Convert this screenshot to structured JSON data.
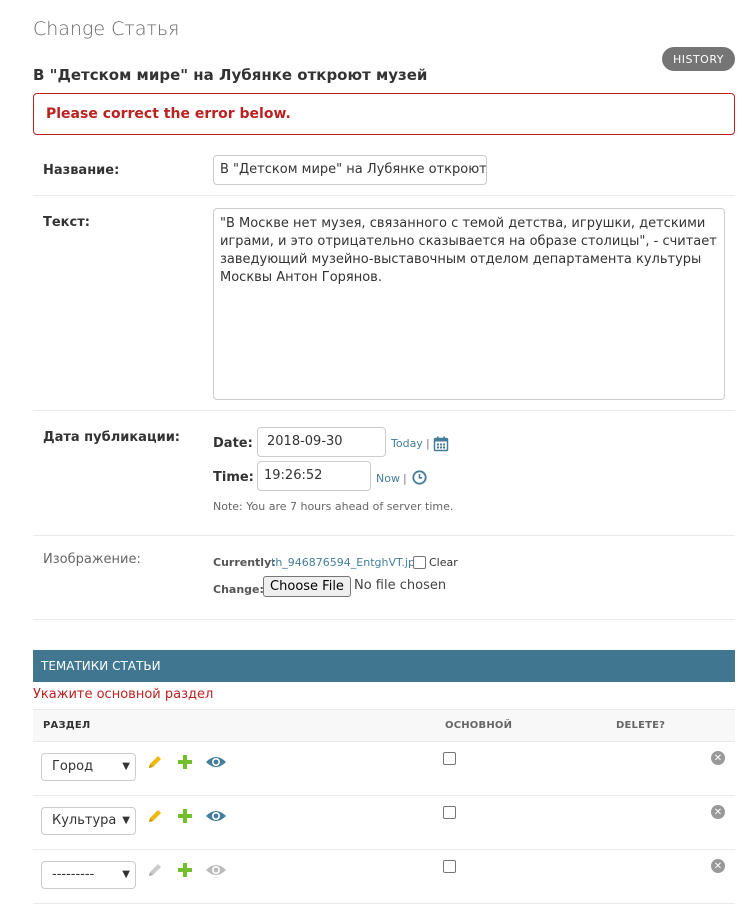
{
  "header": {
    "page_title": "Change Статья",
    "object_title": "В \"Детском мире\" на Лубянке откроют музей",
    "history_label": "HISTORY"
  },
  "errornote": "Please correct the error below.",
  "fields": {
    "title": {
      "label": "Название:",
      "value": "В \"Детском мире\" на Лубянке откроют музей"
    },
    "text": {
      "label": "Текст:",
      "value": "\"В Москве нет музея, связанного с темой детства, игрушки, детскими играми, и это отрицательно сказывается на образе столицы\", - считает заведующий музейно-выставочным отделом департамента культуры Москвы Антон Горянов."
    },
    "pub_date": {
      "label": "Дата публикации:",
      "date_label": "Date:",
      "date_value": "2018-09-30",
      "today_link": "Today",
      "time_label": "Time:",
      "time_value": "19:26:52",
      "now_link": "Now",
      "separator": "|",
      "note": "Note: You are 7 hours ahead of server time."
    },
    "image": {
      "label": "Изображение:",
      "currently_label": "Currently:",
      "current_file": "th_946876594_EntghVT.jpg",
      "clear_label": "Clear",
      "change_label": "Change:",
      "choose_button": "Choose File",
      "no_file": "No file chosen"
    }
  },
  "inline": {
    "header": "ТЕМАТИКИ СТАТЬИ",
    "error": "Укажите основной раздел",
    "columns": {
      "section": "РАЗДЕЛ",
      "main": "ОСНОВНОЙ",
      "delete": "DELETE?"
    },
    "rows": [
      {
        "section": "Город",
        "main": false
      },
      {
        "section": "Культура",
        "main": false
      },
      {
        "section": "---------",
        "main": false
      }
    ]
  },
  "colors": {
    "accent": "#417690",
    "error": "#ba2121",
    "link": "#447e9b",
    "edit_icon": "#efb80b",
    "add_icon": "#70bf2b",
    "view_icon": "#447e9b",
    "disabled_icon": "#bbbbbb"
  },
  "icons": [
    "calendar-icon",
    "clock-icon",
    "pencil-icon",
    "plus-icon",
    "eye-icon",
    "delete-icon"
  ]
}
